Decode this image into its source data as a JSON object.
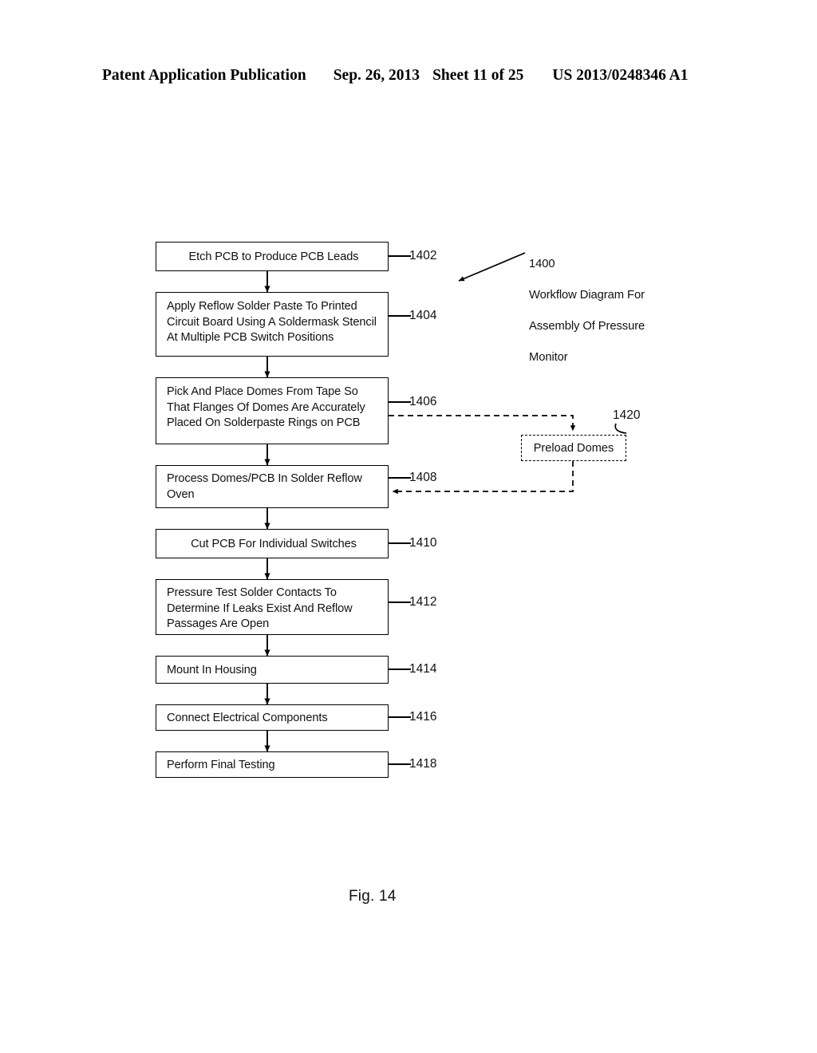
{
  "header": {
    "publication": "Patent Application Publication",
    "date": "Sep. 26, 2013",
    "sheet": "Sheet 11 of 25",
    "patent_number": "US 2013/0248346 A1"
  },
  "figure": {
    "caption": "Fig. 14",
    "callout": {
      "number": "1400",
      "line1": "Workflow Diagram For",
      "line2": "Assembly Of Pressure",
      "line3": "Monitor"
    },
    "steps": [
      {
        "ref": "1402",
        "text": "Etch PCB to Produce PCB Leads"
      },
      {
        "ref": "1404",
        "text": "Apply Reflow Solder Paste To Printed Circuit Board Using A Soldermask Stencil At Multiple PCB Switch Positions"
      },
      {
        "ref": "1406",
        "text": "Pick And Place Domes From Tape So That Flanges Of Domes Are Accurately Placed On Solderpaste Rings on PCB"
      },
      {
        "ref": "1408",
        "text": "Process Domes/PCB In Solder Reflow Oven"
      },
      {
        "ref": "1410",
        "text": "Cut PCB For Individual Switches"
      },
      {
        "ref": "1412",
        "text": "Pressure Test Solder Contacts To Determine If Leaks Exist And Reflow Passages Are Open"
      },
      {
        "ref": "1414",
        "text": "Mount In Housing"
      },
      {
        "ref": "1416",
        "text": "Connect Electrical Components"
      },
      {
        "ref": "1418",
        "text": "Perform Final Testing"
      }
    ],
    "optional_step": {
      "ref": "1420",
      "text": "Preload Domes"
    }
  }
}
